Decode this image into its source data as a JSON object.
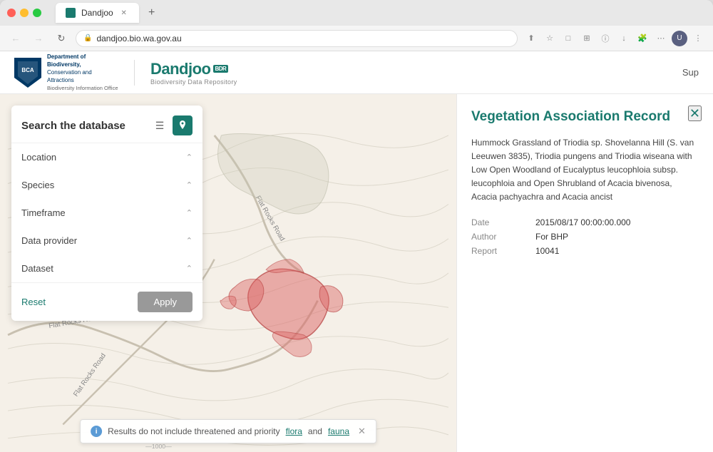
{
  "browser": {
    "tab_title": "Dandjoo",
    "url": "dandjoo.bio.wa.gov.au",
    "new_tab_label": "+",
    "back_btn": "←",
    "forward_btn": "→",
    "reload_btn": "↻"
  },
  "header": {
    "dept_line1": "Department of Biodiversity,",
    "dept_line2": "Conservation and Attractions",
    "dept_line3": "Biodiversity Information Office",
    "logo_name": "Dandjoo",
    "logo_badge": "BDR",
    "logo_subtitle": "Biodiversity Data Repository",
    "nav_link": "Sup"
  },
  "search": {
    "title": "Search the database",
    "list_view_icon": "≡",
    "map_view_icon": "📍",
    "filters": [
      {
        "label": "Location"
      },
      {
        "label": "Species"
      },
      {
        "label": "Timeframe"
      },
      {
        "label": "Data provider"
      },
      {
        "label": "Dataset"
      }
    ],
    "reset_label": "Reset",
    "apply_label": "Apply"
  },
  "detail_panel": {
    "title": "Vegetation Association Record",
    "description": "Hummock Grassland of Triodia sp. Shovelanna Hill (S. van Leeuwen 3835), Triodia pungens and Triodia wiseana with Low Open Woodland of Eucalyptus leucophloia subsp. leucophloia and Open Shrubland of Acacia bivenosa, Acacia pachyachra and Acacia ancist",
    "close_icon": "✕",
    "rows": [
      {
        "label": "Date",
        "value": "2015/08/17 00:00:00.000"
      },
      {
        "label": "Author",
        "value": "For BHP"
      },
      {
        "label": "Report",
        "value": "10041"
      }
    ]
  },
  "notification": {
    "icon": "i",
    "text": "Results do not include threatened and priority ",
    "link1": "flora",
    "separator": " and ",
    "link2": "fauna",
    "close_icon": "✕"
  },
  "map": {
    "road_labels": [
      "Flat Rocks Road",
      "Flat Rocks Road",
      "Flat Rocks Road"
    ]
  }
}
